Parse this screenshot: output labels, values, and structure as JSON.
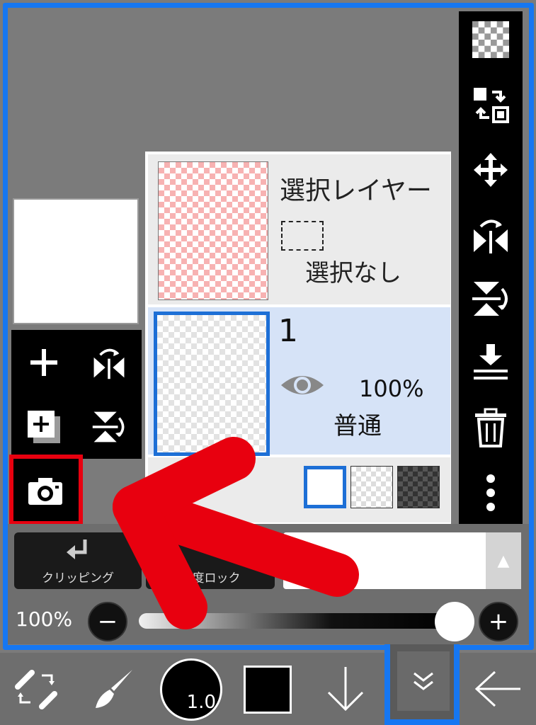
{
  "layers": {
    "selection_layer": {
      "title": "選択レイヤー",
      "status": "選択なし"
    },
    "layer1": {
      "name": "1",
      "opacity": "100%",
      "blend_mode": "普通"
    }
  },
  "controls": {
    "clipping_label": "クリッピング",
    "lock_label": "明度ロック",
    "blend_select_value": "通",
    "opacity_label": "100%",
    "minus": "−",
    "plus": "+",
    "opacity_value": 1.0
  },
  "toolbar": {
    "brush_size": "1.0"
  },
  "colors": {
    "highlight_blue": "#1677f2",
    "annotation_red": "#e8000f",
    "selected_layer_bg": "#d6e3f7"
  },
  "icons": {
    "right_column": [
      "checker-icon",
      "swap-icon",
      "move-icon",
      "flip-h-icon",
      "flip-v-icon",
      "merge-down-icon",
      "trash-icon",
      "more-icon"
    ],
    "left_column": [
      "add-layer-icon",
      "flip-h-icon",
      "duplicate-layer-icon",
      "flip-v-icon",
      "camera-icon"
    ],
    "bottom": [
      "transform-icon",
      "brush-icon",
      "arrow-down-icon",
      "chevron-double-down-icon",
      "arrow-left-icon"
    ]
  }
}
